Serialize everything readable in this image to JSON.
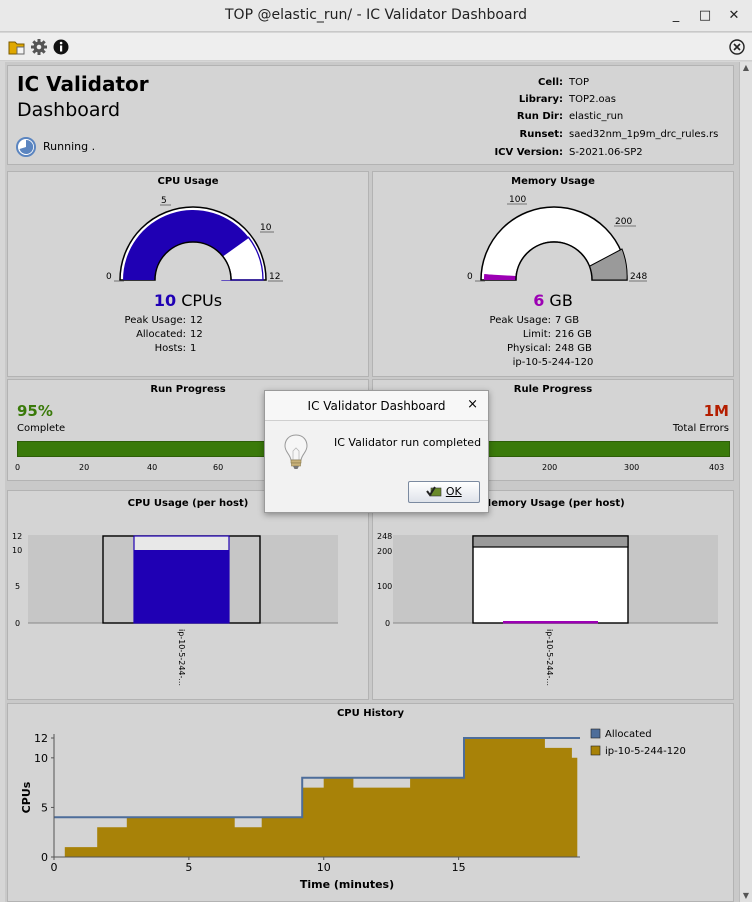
{
  "window": {
    "title": "TOP @elastic_run/ - IC Validator Dashboard",
    "minimize": "_",
    "maximize": "□",
    "close": "✕"
  },
  "toolbar": {
    "open_icon": "folder-open-icon",
    "settings_icon": "gear-icon",
    "info_icon": "info-icon",
    "close_icon": "close-circle-icon"
  },
  "header": {
    "title": "IC Validator",
    "subtitle": "Dashboard",
    "status": "Running .",
    "info": [
      {
        "key": "Cell:",
        "value": "TOP"
      },
      {
        "key": "Library:",
        "value": "TOP2.oas"
      },
      {
        "key": "Run Dir:",
        "value": "elastic_run"
      },
      {
        "key": "Runset:",
        "value": "saed32nm_1p9m_drc_rules.rs"
      },
      {
        "key": "ICV Version:",
        "value": "S-2021.06-SP2"
      }
    ]
  },
  "cpu_usage": {
    "title": "CPU Usage",
    "value": "10",
    "unit": "CPUs",
    "gauge": {
      "min": 0,
      "max": 12,
      "used": 10,
      "ticks": [
        "0",
        "5",
        "10",
        "12"
      ]
    },
    "stats": [
      {
        "key": "Peak Usage:",
        "value": "12"
      },
      {
        "key": "Allocated:",
        "value": "12"
      },
      {
        "key": "Hosts:",
        "value": "1"
      }
    ],
    "color": "#1f00b4"
  },
  "memory_usage": {
    "title": "Memory Usage",
    "value": "6",
    "unit": "GB",
    "gauge": {
      "min": 0,
      "max": 248,
      "used": 6,
      "limit": 216,
      "ticks": [
        "0",
        "100",
        "200",
        "248"
      ]
    },
    "stats": [
      {
        "key": "Peak Usage:",
        "value": "7 GB"
      },
      {
        "key": "Limit:",
        "value": "216 GB"
      },
      {
        "key": "Physical:",
        "value": "248 GB"
      }
    ],
    "host": "ip-10-5-244-120",
    "color": "#9c00b4"
  },
  "run_progress": {
    "title": "Run Progress",
    "percent": "95%",
    "label": "Complete",
    "ticks": [
      "0",
      "20",
      "40",
      "60"
    ],
    "fill_fraction": 0.95,
    "color": "#3a7a0a"
  },
  "rule_progress": {
    "title": "Rule Progress",
    "errors": "1M",
    "label": "Total Errors",
    "ticks": [
      "200",
      "300",
      "403"
    ],
    "color": "#b41e00"
  },
  "cpu_host": {
    "title": "CPU Usage (per host)",
    "ticks": [
      "12",
      "10",
      "5",
      "0"
    ],
    "host_label": "ip-10-5-244-...",
    "allocated": 12,
    "used": 10
  },
  "mem_host": {
    "title": "Memory Usage (per host)",
    "ticks": [
      "248",
      "200",
      "100",
      "0"
    ],
    "host_label": "ip-10-5-244-...",
    "physical": 248,
    "limit": 216,
    "used": 6
  },
  "dialog": {
    "title": "IC Validator Dashboard",
    "close": "×",
    "message": "IC Validator run completed",
    "ok": "OK",
    "icon": "lightbulb-icon"
  },
  "chart_data": {
    "type": "area",
    "title": "CPU History",
    "xlabel": "Time (minutes)",
    "ylabel": "CPUs",
    "xlim": [
      0,
      19.5
    ],
    "ylim": [
      0,
      12
    ],
    "xticks": [
      "0",
      "5",
      "10",
      "15"
    ],
    "yticks": [
      "0",
      "5",
      "10",
      "12"
    ],
    "legend_position": "top-right",
    "series": [
      {
        "name": "Allocated",
        "kind": "step-line",
        "color": "#4d6d9a",
        "x": [
          0,
          9.2,
          9.2,
          15.2,
          15.2,
          19.5
        ],
        "y": [
          4,
          4,
          8,
          8,
          12,
          12
        ]
      },
      {
        "name": "ip-10-5-244-120",
        "kind": "step-area",
        "color": "#a88208",
        "x": [
          0.4,
          1.6,
          1.6,
          2.7,
          2.7,
          6.7,
          6.7,
          7.7,
          7.7,
          9.2,
          9.2,
          10.0,
          10.0,
          11.1,
          11.1,
          13.2,
          13.2,
          15.2,
          15.2,
          18.2,
          18.2,
          19.2,
          19.2,
          19.4
        ],
        "y": [
          1,
          1,
          3,
          3,
          4,
          4,
          3,
          3,
          4,
          4,
          7,
          7,
          8,
          8,
          7,
          7,
          8,
          8,
          12,
          12,
          11,
          11,
          10,
          10
        ]
      }
    ]
  }
}
